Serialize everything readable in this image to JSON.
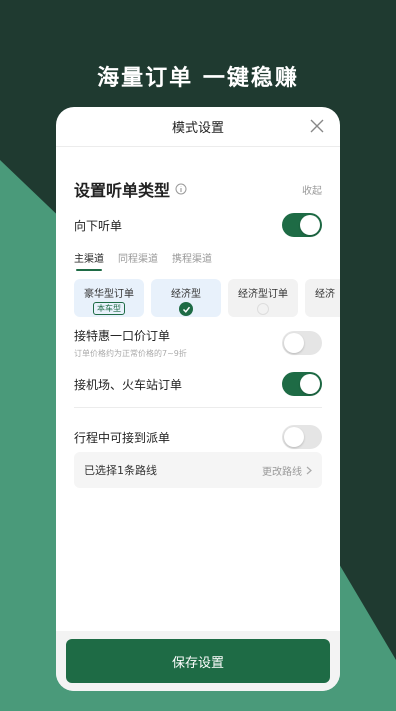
{
  "headline": "海量订单 一键稳赚",
  "modal": {
    "title": "模式设置",
    "section_title": "设置听单类型",
    "collapse_label": "收起",
    "down_order_label": "向下听单",
    "down_order_on": true,
    "tabs": [
      "主渠道",
      "同程渠道",
      "携程渠道"
    ],
    "active_tab": 0,
    "car_types": [
      {
        "label": "豪华型订单",
        "tag": "本车型"
      },
      {
        "label": "经济型",
        "selected": true
      },
      {
        "label": "经济型订单"
      },
      {
        "label": "经济"
      }
    ],
    "special_price": {
      "label": "接特惠一口价订单",
      "sub": "订单价格约为正常价格的7~9折",
      "on": false
    },
    "airport": {
      "label": "接机场、火车站订单",
      "on": true
    },
    "dispatch": {
      "label": "行程中可接到派单",
      "on": false
    },
    "route": {
      "selected_text": "已选择1条路线",
      "change_text": "更改路线"
    },
    "save_label": "保存设置"
  },
  "colors": {
    "dark_bg": "#1f3a30",
    "accent_green": "#1e6b45",
    "light_green": "#4a9a7a"
  }
}
